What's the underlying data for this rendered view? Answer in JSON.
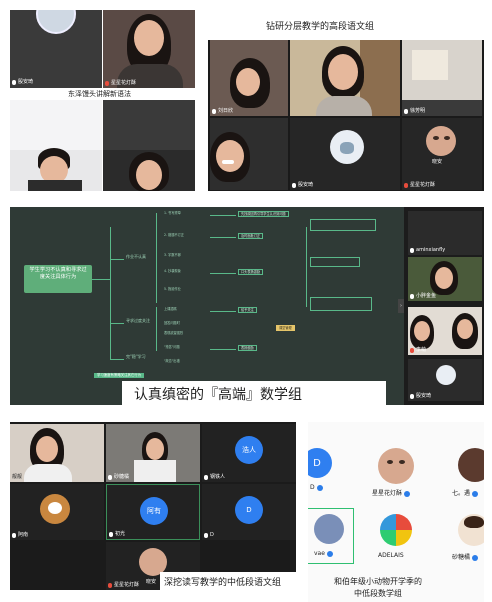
{
  "panel1": {
    "tiles": [
      {
        "name": "殷安琦",
        "mic": "white"
      },
      {
        "name": "星星花灯酥",
        "mic": "red"
      }
    ],
    "caption": "东泽馒头讲解新语法"
  },
  "panel2": {
    "caption": "钻研分层教学的高段语文组",
    "tiles": [
      {
        "name": "刘日欣"
      },
      {
        "name": "徐芳明"
      },
      {
        "name": "殷安琦"
      },
      {
        "name": "星星花灯酥"
      }
    ],
    "avatar_name": "晓安"
  },
  "panel3": {
    "mindmap": {
      "center": "学生学习不认真和寻求过度关注具体行为",
      "branch1": "作业不认真",
      "branch2": "寻求过度关注",
      "branch3": "完\"稳\"学习",
      "nodes": [
        "1. 书写潦草",
        "2. 错题不订正",
        "3. 字数不够",
        "4. 抄袭现象",
        "5. 拖延作业",
        "上课插嘴",
        "回答问题时",
        "表现欲望强烈",
        "\"抢答\"问题",
        "\"故意\"出错"
      ],
      "boxes": [
        "先找原因再引导学生认识到问题",
        "及时面批订正",
        "口头表扬激励",
        "给予关注",
        "表扬鼓励",
        "课堂管理"
      ],
      "footer": "学习速度有策略关注其它行为"
    },
    "sidebar": [
      {
        "name": "aminxianfly"
      },
      {
        "name": "小胖金鱼"
      },
      {
        "name": "李萌"
      },
      {
        "name": "殷安琦"
      }
    ],
    "caption": "认真缜密的『高端』数学组"
  },
  "panel4": {
    "tiles": [
      {
        "name": "靓靓"
      },
      {
        "name": "砂糖橘"
      },
      {
        "name": "晓安"
      },
      {
        "name": "钢铁人"
      },
      {
        "name": "阿南"
      },
      {
        "name": "D"
      },
      {
        "name": "初光"
      },
      {
        "name": "星星花灯酥"
      }
    ],
    "avatar_labels": {
      "haoren": "浩人",
      "ayou": "阿有",
      "d": "D"
    },
    "caption": "深挖读写教学的中低段语文组"
  },
  "panel5": {
    "members": [
      {
        "name": "D",
        "initial": "D"
      },
      {
        "name": "星星花灯酥"
      },
      {
        "name": "七。遇"
      },
      {
        "name": "vae"
      },
      {
        "name": "ADELAIS"
      },
      {
        "name": "砂糖橘"
      }
    ],
    "caption_lines": [
      "和伯年级小动物开学季的",
      "中低段数学组"
    ]
  },
  "colors": {
    "meeting_bg": "#1f1f1f",
    "mindmap_bg": "#2f3a36",
    "mindmap_accent": "#59b889",
    "mindmap_center": "#5fae7a",
    "badge": "#2b7de9",
    "avatar_blue": "#2f7ff0"
  }
}
